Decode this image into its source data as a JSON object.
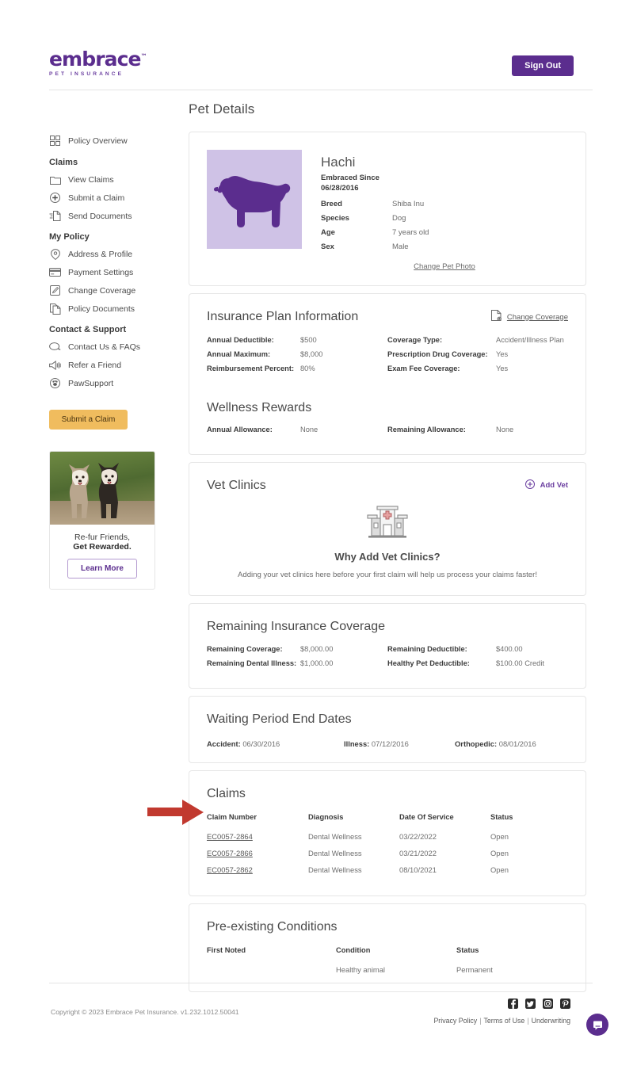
{
  "header": {
    "logo_word": "embrace",
    "logo_tm": "™",
    "logo_sub": "PET INSURANCE",
    "signout_label": "Sign Out"
  },
  "sidebar": {
    "items": [
      {
        "label": "Policy Overview",
        "icon": "grid-icon",
        "type": "link"
      },
      {
        "label": "Claims",
        "type": "group"
      },
      {
        "label": "View Claims",
        "icon": "folder-icon",
        "type": "link"
      },
      {
        "label": "Submit a Claim",
        "icon": "plus-circle-icon",
        "type": "link"
      },
      {
        "label": "Send Documents",
        "icon": "send-document-icon",
        "type": "link"
      },
      {
        "label": "My Policy",
        "type": "group"
      },
      {
        "label": "Address & Profile",
        "icon": "location-pin-icon",
        "type": "link"
      },
      {
        "label": "Payment Settings",
        "icon": "credit-card-icon",
        "type": "link"
      },
      {
        "label": "Change Coverage",
        "icon": "edit-square-icon",
        "type": "link"
      },
      {
        "label": "Policy Documents",
        "icon": "documents-icon",
        "type": "link"
      },
      {
        "label": "Contact & Support",
        "type": "group"
      },
      {
        "label": "Contact Us & FAQs",
        "icon": "chat-bubble-icon",
        "type": "link"
      },
      {
        "label": "Refer a Friend",
        "icon": "megaphone-icon",
        "type": "link"
      },
      {
        "label": "PawSupport",
        "icon": "paw-circle-icon",
        "type": "link"
      }
    ],
    "submit_claim_label": "Submit a Claim",
    "promo": {
      "line1": "Re-fur Friends,",
      "line2": "Get Rewarded.",
      "button_label": "Learn More"
    }
  },
  "main": {
    "page_title": "Pet Details",
    "pet": {
      "name": "Hachi",
      "embraced_since_label": "Embraced Since",
      "embraced_since_value": "06/28/2016",
      "fields": [
        {
          "label": "Breed",
          "value": "Shiba Inu"
        },
        {
          "label": "Species",
          "value": "Dog"
        },
        {
          "label": "Age",
          "value": "7 years old"
        },
        {
          "label": "Sex",
          "value": "Male"
        }
      ],
      "change_photo_label": "Change Pet Photo"
    },
    "plan": {
      "title": "Insurance Plan Information",
      "change_coverage_label": "Change Coverage",
      "left": [
        {
          "label": "Annual Deductible:",
          "value": "$500"
        },
        {
          "label": "Annual Maximum:",
          "value": "$8,000"
        },
        {
          "label": "Reimbursement Percent:",
          "value": "80%"
        }
      ],
      "right": [
        {
          "label": "Coverage Type:",
          "value": "Accident/Illness Plan"
        },
        {
          "label": "Prescription Drug Coverage:",
          "value": "Yes"
        },
        {
          "label": "Exam Fee Coverage:",
          "value": "Yes"
        }
      ]
    },
    "wellness": {
      "title": "Wellness Rewards",
      "left": [
        {
          "label": "Annual Allowance:",
          "value": "None"
        }
      ],
      "right": [
        {
          "label": "Remaining Allowance:",
          "value": "None"
        }
      ]
    },
    "vet_clinics": {
      "title": "Vet Clinics",
      "add_vet_label": "Add Vet",
      "empty_heading": "Why Add Vet Clinics?",
      "empty_desc": "Adding your vet clinics here before your first claim will help us process your claims faster!"
    },
    "remaining": {
      "title": "Remaining Insurance Coverage",
      "left": [
        {
          "label": "Remaining Coverage:",
          "value": "$8,000.00"
        },
        {
          "label": "Remaining Dental Illness:",
          "value": "$1,000.00"
        }
      ],
      "right": [
        {
          "label": "Remaining Deductible:",
          "value": "$400.00"
        },
        {
          "label": "Healthy Pet Deductible:",
          "value": "$100.00 Credit"
        }
      ]
    },
    "waiting": {
      "title": "Waiting Period End Dates",
      "items": [
        {
          "label": "Accident:",
          "value": "06/30/2016"
        },
        {
          "label": "Illness:",
          "value": "07/12/2016"
        },
        {
          "label": "Orthopedic:",
          "value": "08/01/2016"
        }
      ]
    },
    "claims": {
      "title": "Claims",
      "columns": [
        "Claim Number",
        "Diagnosis",
        "Date Of Service",
        "Status"
      ],
      "rows": [
        {
          "claim_number": "EC0057-2864",
          "diagnosis": "Dental Wellness",
          "date_of_service": "03/22/2022",
          "status": "Open"
        },
        {
          "claim_number": "EC0057-2866",
          "diagnosis": "Dental Wellness",
          "date_of_service": "03/21/2022",
          "status": "Open"
        },
        {
          "claim_number": "EC0057-2862",
          "diagnosis": "Dental Wellness",
          "date_of_service": "08/10/2021",
          "status": "Open"
        }
      ]
    },
    "preexisting": {
      "title": "Pre-existing Conditions",
      "columns": [
        "First Noted",
        "Condition",
        "Status"
      ],
      "rows": [
        {
          "first_noted": "",
          "condition": "Healthy animal",
          "status": "Permanent"
        }
      ]
    }
  },
  "annotation": {
    "arrow_color": "#c1392f",
    "points_to": "EC0057-2864"
  },
  "footer": {
    "copyright": "Copyright © 2023   Embrace Pet Insurance. v1.232.1012.50041",
    "social": [
      "facebook-icon",
      "twitter-icon",
      "instagram-icon",
      "pinterest-icon"
    ],
    "links": [
      "Privacy Policy",
      "Terms of Use",
      "Underwriting"
    ],
    "separator": "|"
  },
  "colors": {
    "brand_purple": "#5b2d8e",
    "accent_gold": "#f0bc5e",
    "pet_photo_bg": "#cfc2e6",
    "pet_silhouette": "#5b2d8e",
    "arrow_red": "#c1392f"
  }
}
